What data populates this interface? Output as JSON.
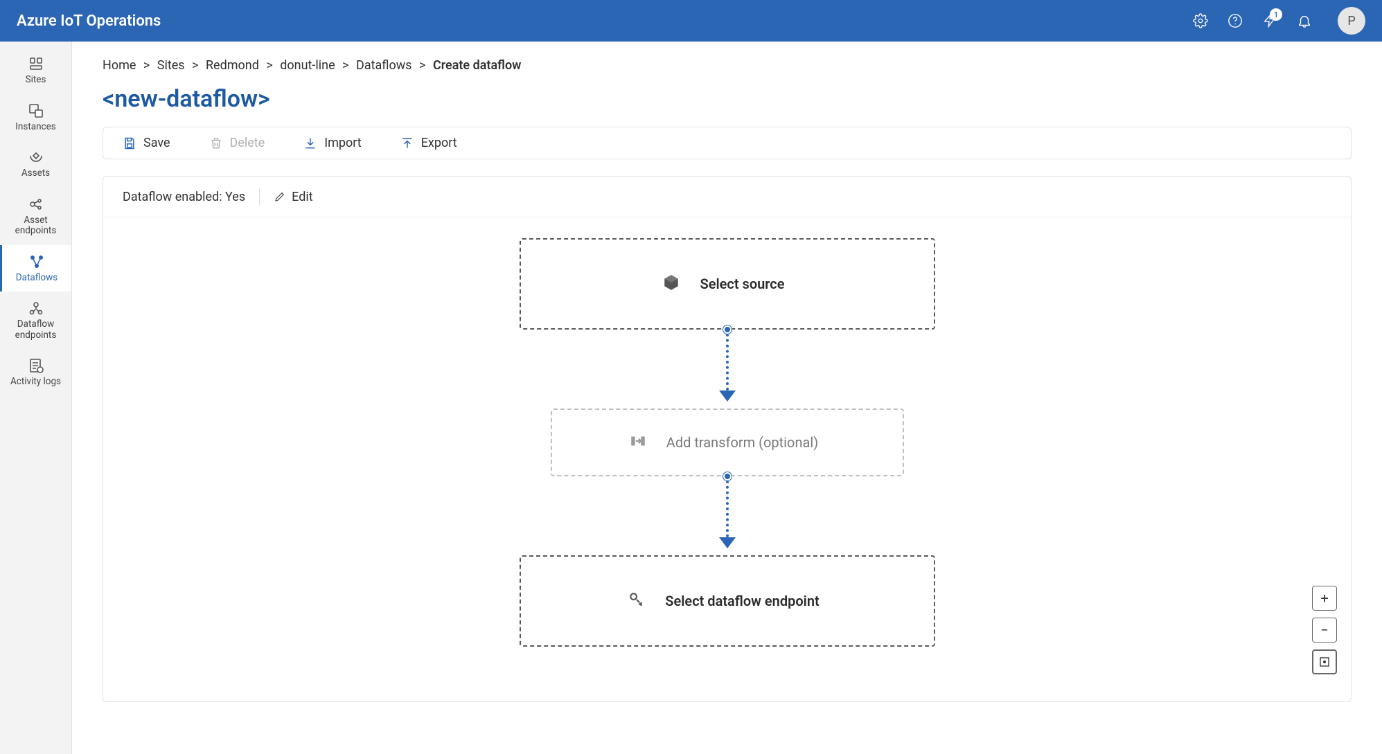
{
  "brand": "Azure IoT Operations",
  "top_actions": {
    "ring_badge": "1",
    "avatar_initial": "P"
  },
  "rail": [
    {
      "id": "sites",
      "label": "Sites"
    },
    {
      "id": "instances",
      "label": "Instances"
    },
    {
      "id": "assets",
      "label": "Assets"
    },
    {
      "id": "asset-endpoints",
      "label": "Asset endpoints"
    },
    {
      "id": "dataflows",
      "label": "Dataflows",
      "active": true
    },
    {
      "id": "dataflow-endpoints",
      "label": "Dataflow endpoints"
    },
    {
      "id": "activity-logs",
      "label": "Activity logs"
    }
  ],
  "breadcrumb": {
    "items": [
      "Home",
      "Sites",
      "Redmond",
      "donut-line",
      "Dataflows"
    ],
    "current": "Create dataflow",
    "separator": ">"
  },
  "page_title": "<new-dataflow>",
  "toolbar": {
    "save": "Save",
    "delete": "Delete",
    "import": "Import",
    "export": "Export"
  },
  "canvas": {
    "enabled_label": "Dataflow enabled:",
    "enabled_value": "Yes",
    "edit_label": "Edit",
    "nodes": {
      "source": "Select source",
      "transform": "Add transform (optional)",
      "destination": "Select dataflow endpoint"
    }
  },
  "zoom": {
    "in": "+",
    "out": "−",
    "fit": "⛶"
  }
}
